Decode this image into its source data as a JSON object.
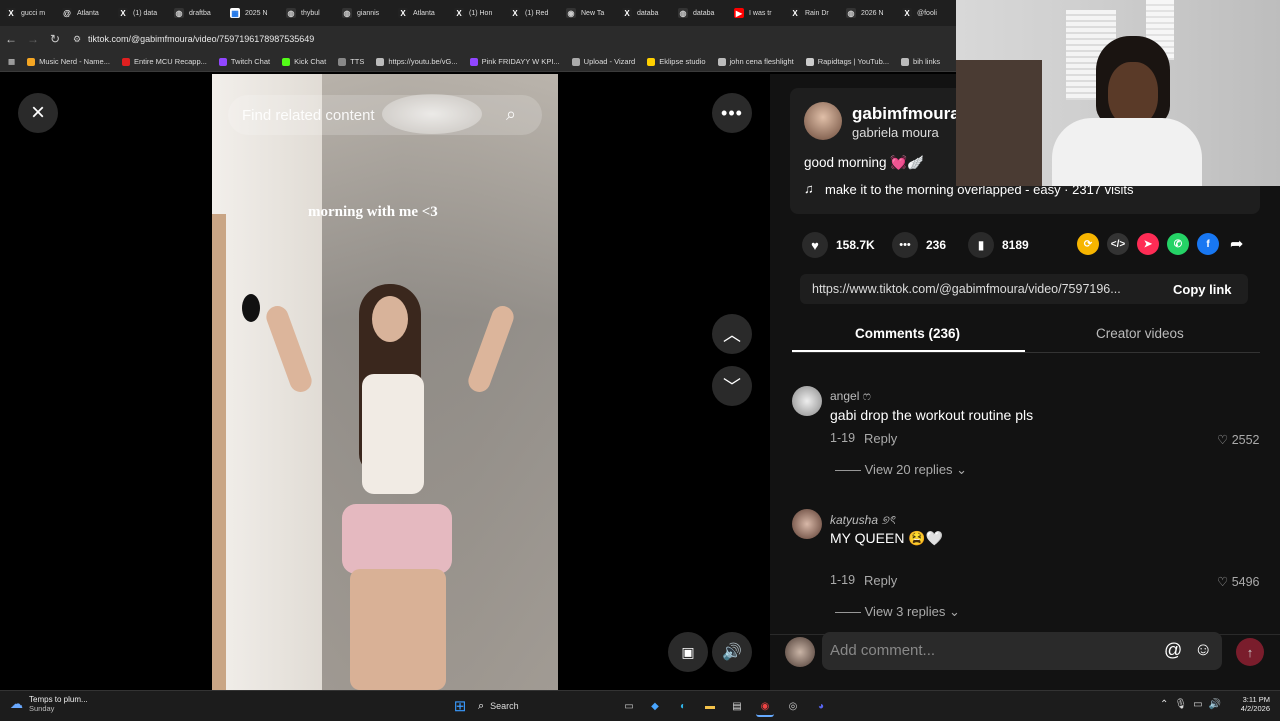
{
  "tabs": [
    {
      "label": "gucci m",
      "icon": "x-icon"
    },
    {
      "label": "Atlanta",
      "icon": "threads-icon"
    },
    {
      "label": "(1) data",
      "icon": "x-icon"
    },
    {
      "label": "draftba",
      "icon": "globe-icon"
    },
    {
      "label": "2025 N",
      "icon": "sheet-icon"
    },
    {
      "label": "thybul",
      "icon": "globe-icon"
    },
    {
      "label": "giannis",
      "icon": "globe-icon"
    },
    {
      "label": "Atlanta",
      "icon": "x-icon"
    },
    {
      "label": "(1) Hon",
      "icon": "x-icon"
    },
    {
      "label": "(1) Red",
      "icon": "x-icon"
    },
    {
      "label": "New Ta",
      "icon": "chrome-icon"
    },
    {
      "label": "databa",
      "icon": "x-icon"
    },
    {
      "label": "databa",
      "icon": "globe-icon"
    },
    {
      "label": "I was tr",
      "icon": "youtube-icon"
    },
    {
      "label": "Rain Dr",
      "icon": "x-icon"
    },
    {
      "label": "2026 N",
      "icon": "globe-icon"
    },
    {
      "label": "@fooli",
      "icon": "x-icon"
    }
  ],
  "address": {
    "url": "tiktok.com/@gabimfmoura/video/7597196178987535649"
  },
  "bookmarks": [
    {
      "label": "Music Nerd - Name...",
      "color": "#f5a623"
    },
    {
      "label": "Entire MCU Recapp...",
      "color": "#e02020"
    },
    {
      "label": "Twitch Chat",
      "color": "#9146ff"
    },
    {
      "label": "Kick Chat",
      "color": "#53fc18"
    },
    {
      "label": "TTS",
      "color": "#888888"
    },
    {
      "label": "https://youtu.be/vG...",
      "color": "#bbbbbb"
    },
    {
      "label": "Pink FRIDAYY W KPI...",
      "color": "#9146ff"
    },
    {
      "label": "Upload - Vizard",
      "color": "#aaaaaa"
    },
    {
      "label": "Eklipse studio",
      "color": "#ffd000"
    },
    {
      "label": "john cena fleshlight",
      "color": "#bbbbbb"
    },
    {
      "label": "Rapidtags | YouTub...",
      "color": "#cccccc"
    },
    {
      "label": "bih links",
      "color": "#bbbbbb"
    }
  ],
  "video": {
    "search_placeholder": "Find related content",
    "overlay_text": "morning with me <3"
  },
  "author": {
    "username": "gabimfmoura",
    "display_name": "gabriela moura",
    "caption": "good morning 💓🪽",
    "music": "make it to the morning overlapped - easy · 2317 visits"
  },
  "stats": {
    "likes": "158.7K",
    "comments": "236",
    "saves": "8189"
  },
  "share_link": {
    "url": "https://www.tiktok.com/@gabimfmoura/video/7597196...",
    "button": "Copy link"
  },
  "tabs_panel": {
    "comments": "Comments (236)",
    "creator": "Creator videos"
  },
  "comments": [
    {
      "name": "angel ෆ",
      "text": "gabi drop the workout routine pls",
      "date": "1-19",
      "reply": "Reply",
      "likes": "2552",
      "replies": "View 20 replies"
    },
    {
      "name": "katyusha ୭ৎ",
      "text": "MY QUEEN 😫🤍",
      "date": "1-19",
      "reply": "Reply",
      "likes": "5496",
      "replies": "View 3 replies"
    }
  ],
  "comment_input": {
    "placeholder": "Add comment..."
  },
  "taskbar": {
    "weather_title": "Temps to plum...",
    "weather_sub": "Sunday",
    "search": "Search",
    "time": "3:11 PM",
    "date": "4/2/2026"
  },
  "colors": {
    "accent": "#fe2c55",
    "panel": "#121212",
    "tiktok_red": "#fe2c55"
  }
}
